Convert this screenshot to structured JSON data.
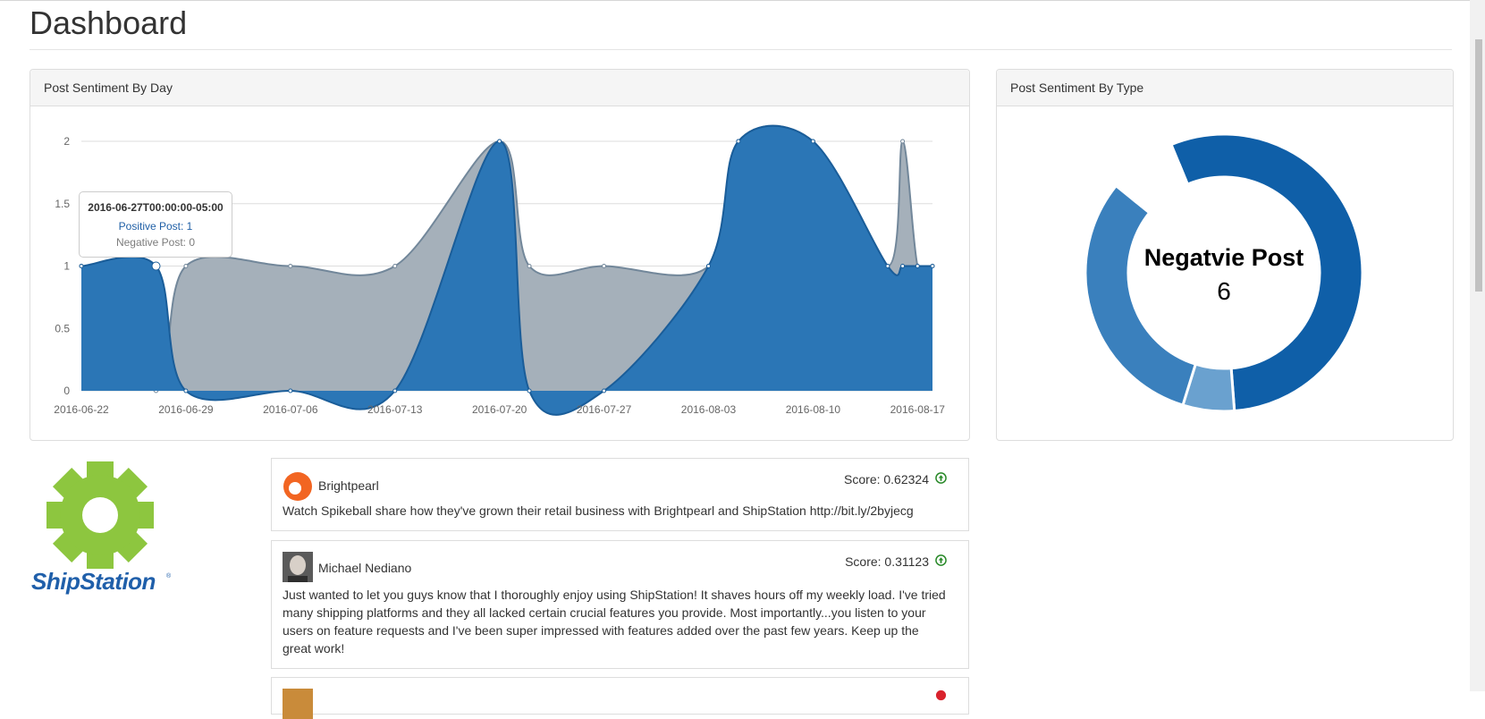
{
  "page": {
    "title": "Dashboard"
  },
  "panels": {
    "by_day": {
      "title": "Post Sentiment By Day"
    },
    "by_type": {
      "title": "Post Sentiment By Type"
    }
  },
  "colors": {
    "positive": "#2b76b6",
    "negative": "#a5b0ba",
    "dark": "#1f5fa6",
    "light": "#6c9fcd"
  },
  "chart_data": [
    {
      "type": "area",
      "x": [
        "2016-06-22",
        "2016-06-27",
        "2016-06-29",
        "2016-07-06",
        "2016-07-13",
        "2016-07-20",
        "2016-07-22",
        "2016-07-27",
        "2016-08-03",
        "2016-08-05",
        "2016-08-10",
        "2016-08-15",
        "2016-08-16",
        "2016-08-17",
        "2016-08-18"
      ],
      "series": [
        {
          "name": "Positive Post",
          "values": [
            1,
            1,
            0,
            0,
            0,
            2,
            0,
            0,
            1,
            2,
            2,
            1,
            1,
            1,
            1
          ]
        },
        {
          "name": "Negative Post",
          "values": [
            1,
            0,
            1,
            1,
            1,
            2,
            1,
            1,
            1,
            2,
            2,
            1,
            2,
            1,
            1
          ]
        }
      ],
      "tick_labels": [
        "2016-06-22",
        "2016-06-29",
        "2016-07-06",
        "2016-07-13",
        "2016-07-20",
        "2016-07-27",
        "2016-08-03",
        "2016-08-10",
        "2016-08-17"
      ],
      "y_ticks": [
        "0",
        "0.5",
        "1",
        "1.5",
        "2"
      ],
      "ylim": [
        0,
        2
      ],
      "grid": true,
      "tooltip": {
        "title": "2016-06-27T00:00:00-05:00",
        "positive": "Positive Post: 1",
        "negative": "Negative Post: 0"
      }
    },
    {
      "type": "pie",
      "donut": true,
      "series": [
        {
          "name": "",
          "values": [
            0.55,
            0.06,
            0.31,
            0.08
          ]
        }
      ],
      "center_label": "Negatvie Post",
      "center_value": "6"
    }
  ],
  "brand": {
    "logo_text": "ShipStation",
    "logo_icon": "gear-icon"
  },
  "posts": [
    {
      "name": "Brightpearl",
      "score": "Score: 0.62324",
      "text": "Watch Spikeball share how they've grown their retail business with Brightpearl and ShipStation http://bit.ly/2byjecg",
      "avatar": "brightpearl-logo",
      "sentiment": "up-arrow-icon"
    },
    {
      "name": "Michael Nediano",
      "score": "Score: 0.31123",
      "text": "Just wanted to let you guys know that I thoroughly enjoy using ShipStation! It shaves hours off my weekly load. I've tried many shipping platforms and they all lacked certain crucial features you provide. Most importantly...you listen to your users on feature requests and I've been super impressed with features added over the past few years. Keep up the great work!",
      "avatar": "user-photo",
      "sentiment": "up-arrow-icon"
    }
  ]
}
